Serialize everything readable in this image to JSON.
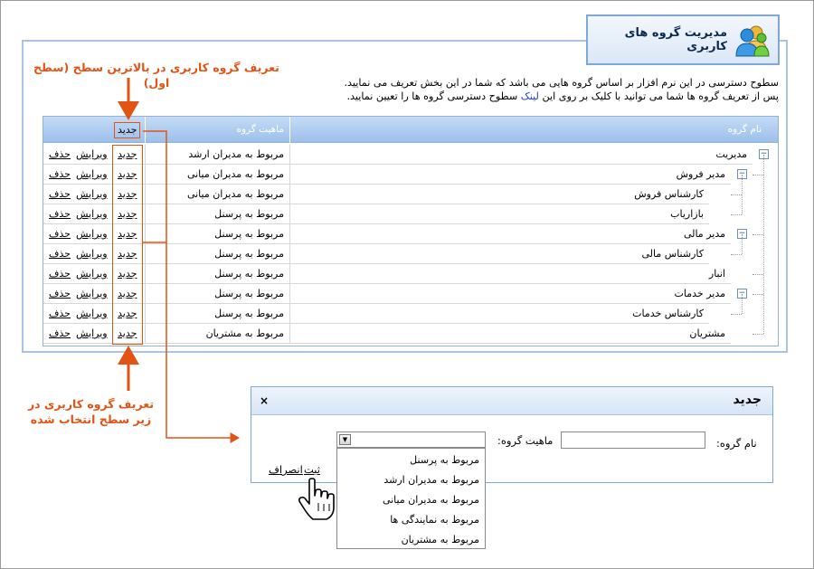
{
  "page": {
    "title": "مدیریت گروه های کاربری",
    "description_lines": [
      "سطوح دسترسی در این نرم افزار بر اساس گروه هایی می باشد که شما در این بخش تعریف می نمایید.",
      "پس از تعریف گروه ها شما می توانید با کلیک بر روی این",
      "لینک",
      "سطوح دسترسی گروه ها را تعیین نمایید."
    ]
  },
  "table": {
    "headers": {
      "name": "نام گروه",
      "nature": "ماهیت گروه",
      "new": "جدید"
    },
    "action_labels": {
      "new": "جدید",
      "edit": "ویرایش",
      "delete": "حذف"
    },
    "rows": [
      {
        "name": "مدیریت",
        "nature": "مربوط به مدیران ارشد",
        "level": 0,
        "toggle": "−"
      },
      {
        "name": "مدیر فروش",
        "nature": "مربوط به مدیران میانی",
        "level": 1,
        "toggle": "−"
      },
      {
        "name": "کارشناس فروش",
        "nature": "مربوط به مدیران میانی",
        "level": 2,
        "toggle": ""
      },
      {
        "name": "بازاریاب",
        "nature": "مربوط به پرسنل",
        "level": 2,
        "toggle": ""
      },
      {
        "name": "مدیر مالی",
        "nature": "مربوط به پرسنل",
        "level": 1,
        "toggle": "−"
      },
      {
        "name": "کارشناس مالی",
        "nature": "مربوط به پرسنل",
        "level": 2,
        "toggle": ""
      },
      {
        "name": "انبار",
        "nature": "مربوط به پرسنل",
        "level": 1,
        "toggle": ""
      },
      {
        "name": "مدیر خدمات",
        "nature": "مربوط به پرسنل",
        "level": 1,
        "toggle": "−"
      },
      {
        "name": "کارشناس خدمات",
        "nature": "مربوط به پرسنل",
        "level": 2,
        "toggle": ""
      },
      {
        "name": "مشتریان",
        "nature": "مربوط به مشتریان",
        "level": 1,
        "toggle": ""
      }
    ]
  },
  "annotations": {
    "top": "تعریف گروه کاربری در بالاترین سطح (سطح اول)",
    "bottom": "تعریف گروه کاربری در زیر سطح انتخاب شده"
  },
  "dialog": {
    "title": "جدید",
    "close": "×",
    "name_label": "نام گروه:",
    "name_value": "",
    "nature_label": "ماهیت گروه:",
    "nature_selected": "",
    "options": [
      "مربوط به پرسنل",
      "مربوط به مدیران ارشد",
      "مربوط به مدیران میانی",
      "مربوط به نمایندگی ها",
      "مربوط به مشتریان"
    ],
    "save": "ثبت",
    "cancel": "انصراف"
  },
  "colors": {
    "accent_orange": "#e35314",
    "header_blue": "#9cc0ea",
    "border_blue": "#8fb2dc",
    "link_blue": "#1a3fd6"
  }
}
